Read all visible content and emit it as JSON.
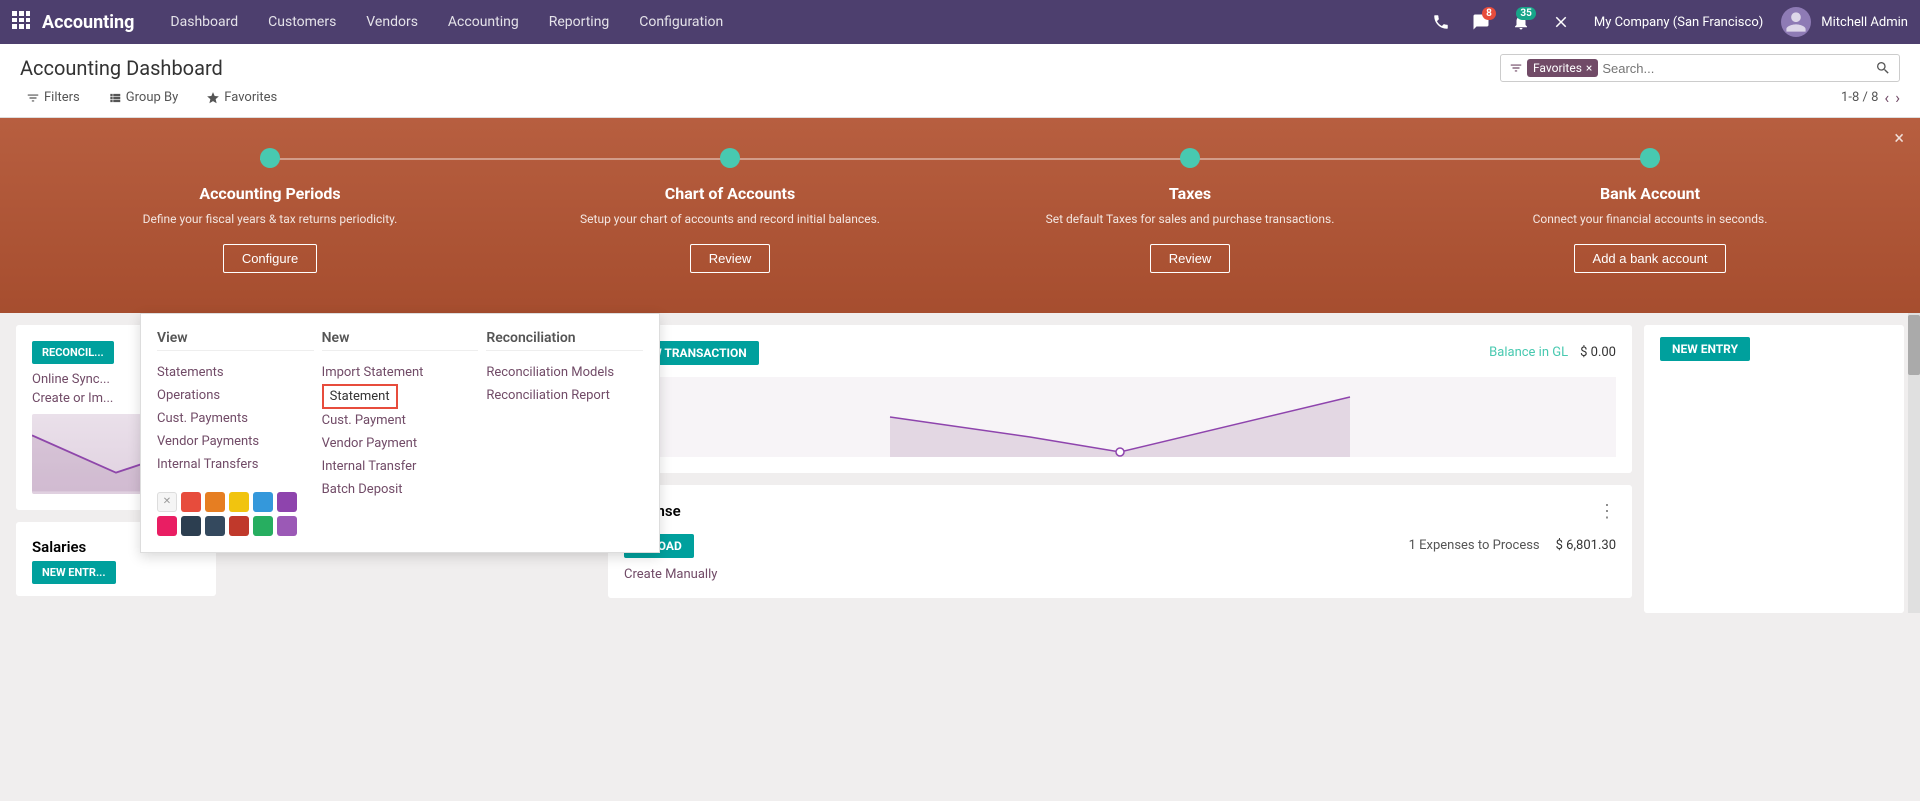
{
  "nav": {
    "app_title": "Accounting",
    "menu_items": [
      "Dashboard",
      "Customers",
      "Vendors",
      "Accounting",
      "Reporting",
      "Configuration"
    ],
    "badge_messages": "8",
    "badge_activity": "35",
    "company": "My Company (San Francisco)",
    "username": "Mitchell Admin"
  },
  "header": {
    "page_title": "Accounting Dashboard",
    "search_tag": "Favorites",
    "search_tag_close": "×",
    "search_placeholder": "Search...",
    "filter_label": "Filters",
    "groupby_label": "Group By",
    "favorites_label": "Favorites",
    "pagination": "1-8 / 8"
  },
  "banner": {
    "close": "×",
    "steps": [
      {
        "title": "Accounting Periods",
        "desc": "Define your fiscal years & tax returns periodicity.",
        "btn": "Configure"
      },
      {
        "title": "Chart of Accounts",
        "desc": "Setup your chart of accounts and record initial balances.",
        "btn": "Review"
      },
      {
        "title": "Taxes",
        "desc": "Set default Taxes for sales and purchase transactions.",
        "btn": "Review"
      },
      {
        "title": "Bank Account",
        "desc": "Connect your financial accounts in seconds.",
        "btn": "Add a bank account"
      }
    ]
  },
  "dropdown": {
    "view": {
      "header": "View",
      "items": [
        "Statements",
        "Operations",
        "Cust. Payments",
        "Vendor Payments",
        "Internal Transfers"
      ]
    },
    "new": {
      "header": "New",
      "items": [
        "Import Statement",
        "Statement",
        "Cust. Payment",
        "Vendor Payment",
        "Internal Transfer",
        "Batch Deposit"
      ]
    },
    "reconciliation": {
      "header": "Reconciliation",
      "items": [
        "Reconciliation Models",
        "Reconciliation Report"
      ]
    },
    "colors": [
      "#e74c3c",
      "#e67e22",
      "#f1c40f",
      "#3498db",
      "#8e44ad",
      "#e91e63",
      "#2c3e50",
      "#34495e",
      "#c0392b",
      "#27ae60",
      "#9b59b6"
    ],
    "highlighted_item": "Statement"
  },
  "cards": {
    "reconcile": {
      "badge": "RECONCIL...",
      "link1": "Online Sync...",
      "link2": "Create or Im..."
    },
    "transaction": {
      "badge": "NEW TRANSACTION",
      "balance_label": "Balance in GL",
      "balance_amount": "$ 0.00"
    },
    "new_entry": {
      "badge": "NEW ENTRY"
    },
    "salaries": {
      "title": "Salaries",
      "badge": "NEW ENTR..."
    },
    "expense": {
      "title": "Expense",
      "upload_btn": "UPLOAD",
      "expense_text": "1 Expenses to Process",
      "expense_amount": "$ 6,801.30",
      "create_manually": "Create Manually"
    }
  }
}
